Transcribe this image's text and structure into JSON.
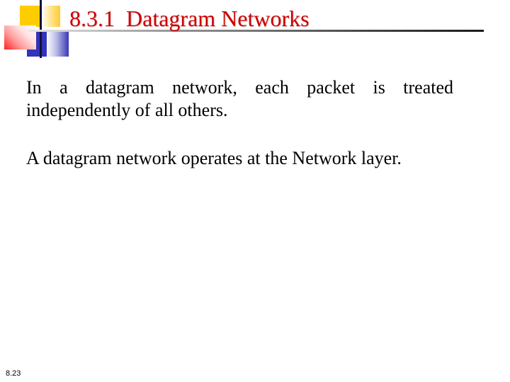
{
  "slide": {
    "title": "8.3.1  Datagram Networks",
    "paragraphs": [
      "In a datagram network, each packet is treated independently of all others.",
      "A datagram network operates at the Network layer."
    ],
    "slide_number": "8.23"
  },
  "colors": {
    "title": "#cc0000",
    "body_text": "#000000",
    "logo_yellow": "#ffcc00",
    "logo_blue": "#3333bb",
    "logo_red": "#ff2020"
  },
  "icons": {
    "logo": "decorative-squares-logo"
  }
}
